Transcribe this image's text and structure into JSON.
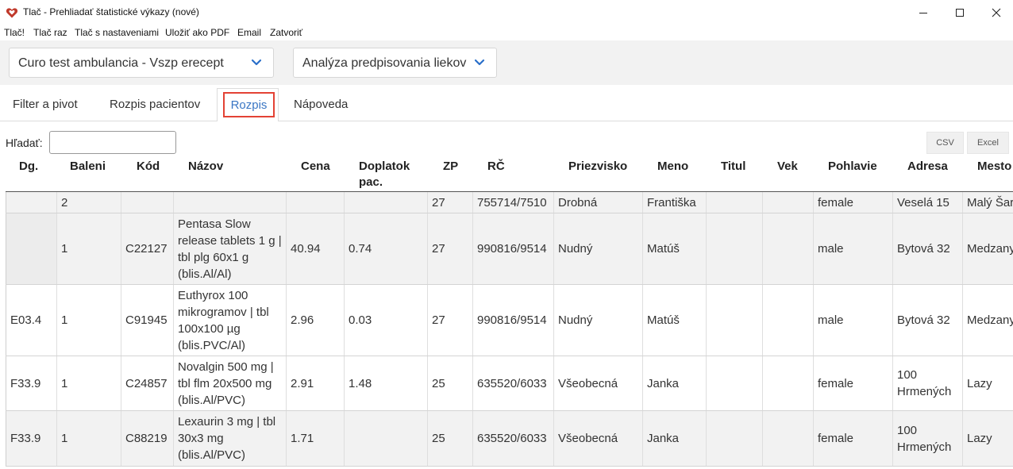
{
  "window": {
    "title": "Tlač - Prehliadať štatistické výkazy (nové)"
  },
  "menu": [
    "Tlač!",
    "Tlač raz",
    "Tlač s nastaveniami",
    "Uložiť ako PDF",
    "Email",
    "Zatvoriť"
  ],
  "selectors": {
    "clinic": "Curo test ambulancia - Vszp erecept",
    "report": "Analýza predpisovania liekov"
  },
  "tabs": [
    "Filter a pivot",
    "Rozpis pacientov",
    "Rozpis",
    "Nápoveda"
  ],
  "active_tab": "Rozpis",
  "search": {
    "label": "Hľadať:",
    "value": ""
  },
  "export": {
    "csv": "CSV",
    "excel": "Excel"
  },
  "table": {
    "headers": [
      "Dg.",
      "Baleni",
      "Kód",
      "Názov",
      "Cena",
      "Doplatok pac.",
      "ZP",
      "RČ",
      "Priezvisko",
      "Meno",
      "Titul",
      "Vek",
      "Pohlavie",
      "Adresa",
      "Mesto"
    ],
    "rows": [
      [
        "",
        "2",
        "",
        "",
        "",
        "",
        "27",
        "755714/7510",
        "Drobná",
        "Františka",
        "",
        "",
        "female",
        "Veselá 15",
        "Malý Šariš"
      ],
      [
        "",
        "1",
        "C22127",
        "Pentasa Slow release tablets 1 g | tbl plg 60x1 g (blis.Al/Al)",
        "40.94",
        "0.74",
        "27",
        "990816/9514",
        "Nudný",
        "Matúš",
        "",
        "",
        "male",
        "Bytová 32",
        "Medzany"
      ],
      [
        "E03.4",
        "1",
        "C91945",
        "Euthyrox 100 mikrogramov | tbl 100x100 µg (blis.PVC/Al)",
        "2.96",
        "0.03",
        "27",
        "990816/9514",
        "Nudný",
        "Matúš",
        "",
        "",
        "male",
        "Bytová 32",
        "Medzany"
      ],
      [
        "F33.9",
        "1",
        "C24857",
        "Novalgin 500 mg | tbl flm 20x500 mg (blis.Al/PVC)",
        "2.91",
        "1.48",
        "25",
        "635520/6033",
        "Všeobecná",
        "Janka",
        "",
        "",
        "female",
        "100 Hrmených",
        "Lazy"
      ],
      [
        "F33.9",
        "1",
        "C88219",
        "Lexaurin 3 mg | tbl 30x3 mg (blis.Al/PVC)",
        "1.71",
        "",
        "25",
        "635520/6033",
        "Všeobecná",
        "Janka",
        "",
        "",
        "female",
        "100 Hrmených",
        "Lazy"
      ]
    ],
    "row_shading": [
      "#f2f2f2",
      "#f2f2f2",
      "#ffffff",
      "#ffffff",
      "#f2f2f2"
    ]
  },
  "colors": {
    "accent": "#e34234",
    "link": "#3a76c4",
    "chevron": "#2a6fc9",
    "logo_red": "#c0392b"
  },
  "icons": {
    "app": "heart-logo-icon",
    "minimize": "minimize-icon",
    "maximize": "maximize-icon",
    "close": "close-icon",
    "dropdown": "chevron-down-icon"
  }
}
